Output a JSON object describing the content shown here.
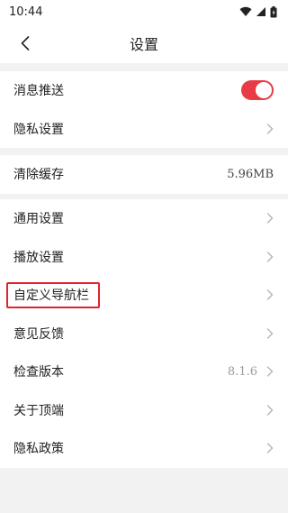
{
  "status_bar": {
    "time": "10:44"
  },
  "header": {
    "title": "设置"
  },
  "colors": {
    "accent": "#e83b45",
    "chevron": "#b5b5b5",
    "highlight": "#e0232e"
  },
  "section1": {
    "push": {
      "label": "消息推送",
      "toggle_on": true
    },
    "privacy_settings": {
      "label": "隐私设置"
    }
  },
  "section2": {
    "clear_cache": {
      "label": "清除缓存",
      "value": "5.96MB"
    }
  },
  "section3": {
    "general": {
      "label": "通用设置"
    },
    "playback": {
      "label": "播放设置"
    },
    "custom_nav": {
      "label": "自定义导航栏"
    },
    "feedback": {
      "label": "意见反馈"
    },
    "check_version": {
      "label": "检查版本",
      "value": "8.1.6"
    },
    "about": {
      "label": "关于顶端"
    },
    "privacy_policy": {
      "label": "隐私政策"
    }
  }
}
